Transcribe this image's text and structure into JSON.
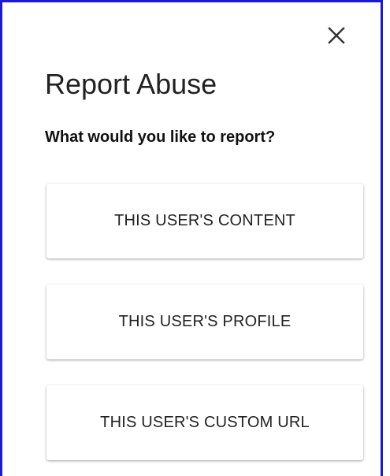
{
  "dialog": {
    "title": "Report Abuse",
    "question": "What would you like to report?",
    "close_icon": "close-icon",
    "options": [
      {
        "label": "THIS USER'S CONTENT"
      },
      {
        "label": "THIS USER'S PROFILE"
      },
      {
        "label": "THIS USER'S CUSTOM URL"
      }
    ]
  },
  "colors": {
    "frame_border": "#1a1ad6",
    "text": "#222222",
    "background": "#ffffff"
  }
}
